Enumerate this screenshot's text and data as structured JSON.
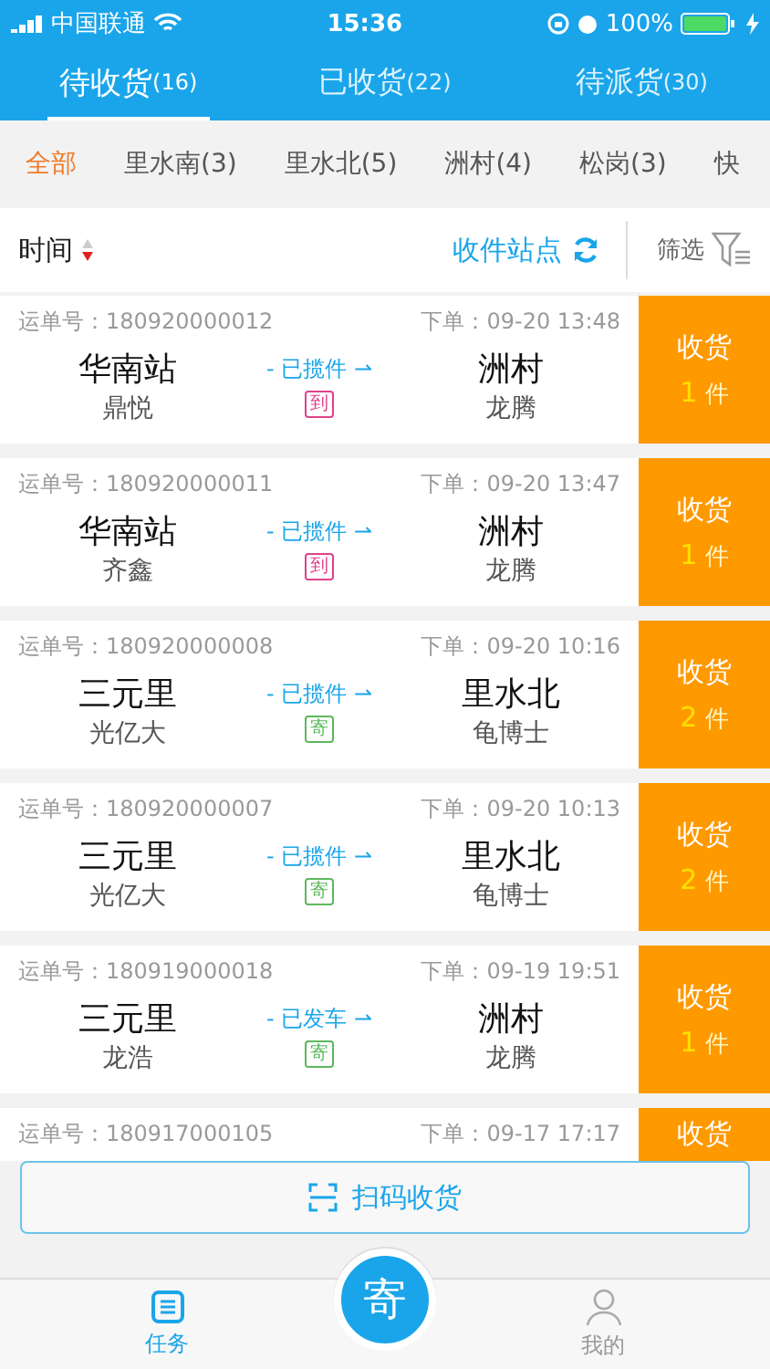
{
  "status_bar": {
    "carrier": "中国联通",
    "time": "15:36",
    "battery": "100%"
  },
  "tabs": [
    {
      "label": "待收货",
      "count": "(16)",
      "selected": true
    },
    {
      "label": "已收货",
      "count": "(22)",
      "selected": false
    },
    {
      "label": "待派货",
      "count": "(30)",
      "selected": false
    }
  ],
  "stations": [
    {
      "label": "全部",
      "selected": true
    },
    {
      "label": "里水南(3)",
      "selected": false
    },
    {
      "label": "里水北(5)",
      "selected": false
    },
    {
      "label": "洲村(4)",
      "selected": false
    },
    {
      "label": "松岗(3)",
      "selected": false
    },
    {
      "label": "快",
      "selected": false
    }
  ],
  "sort_bar": {
    "sort_label": "时间",
    "station_label": "收件站点",
    "filter_label": "筛选"
  },
  "orders": [
    {
      "waybill": "运单号：180920000012",
      "ordered": "下单：09-20 13:48",
      "from": "华南站",
      "from_name": "鼎悦",
      "status": "- 已揽件 ⇀",
      "badge": {
        "kind": "arrive",
        "text": "到"
      },
      "to": "洲村",
      "to_name": "龙腾",
      "action": "收货",
      "qty": "1",
      "unit": "件"
    },
    {
      "waybill": "运单号：180920000011",
      "ordered": "下单：09-20 13:47",
      "from": "华南站",
      "from_name": "齐鑫",
      "status": "- 已揽件 ⇀",
      "badge": {
        "kind": "arrive",
        "text": "到"
      },
      "to": "洲村",
      "to_name": "龙腾",
      "action": "收货",
      "qty": "1",
      "unit": "件"
    },
    {
      "waybill": "运单号：180920000008",
      "ordered": "下单：09-20 10:16",
      "from": "三元里",
      "from_name": "光亿大",
      "status": "- 已揽件 ⇀",
      "badge": {
        "kind": "send",
        "text": "寄"
      },
      "to": "里水北",
      "to_name": "龟博士",
      "action": "收货",
      "qty": "2",
      "unit": "件"
    },
    {
      "waybill": "运单号：180920000007",
      "ordered": "下单：09-20 10:13",
      "from": "三元里",
      "from_name": "光亿大",
      "status": "- 已揽件 ⇀",
      "badge": {
        "kind": "send",
        "text": "寄"
      },
      "to": "里水北",
      "to_name": "龟博士",
      "action": "收货",
      "qty": "2",
      "unit": "件"
    },
    {
      "waybill": "运单号：180919000018",
      "ordered": "下单：09-19 19:51",
      "from": "三元里",
      "from_name": "龙浩",
      "status": "- 已发车 ⇀",
      "badge": {
        "kind": "send",
        "text": "寄"
      },
      "to": "洲村",
      "to_name": "龙腾",
      "action": "收货",
      "qty": "1",
      "unit": "件"
    },
    {
      "waybill": "运单号：180917000105",
      "ordered": "下单：09-17 17:17",
      "action": "收货"
    }
  ],
  "scan_button": "扫码收货",
  "bottom_nav": [
    {
      "label": "任务",
      "kind": "tasks",
      "selected": true
    },
    {
      "label": "寄",
      "kind": "center"
    },
    {
      "label": "我的",
      "kind": "profile",
      "selected": false
    }
  ]
}
